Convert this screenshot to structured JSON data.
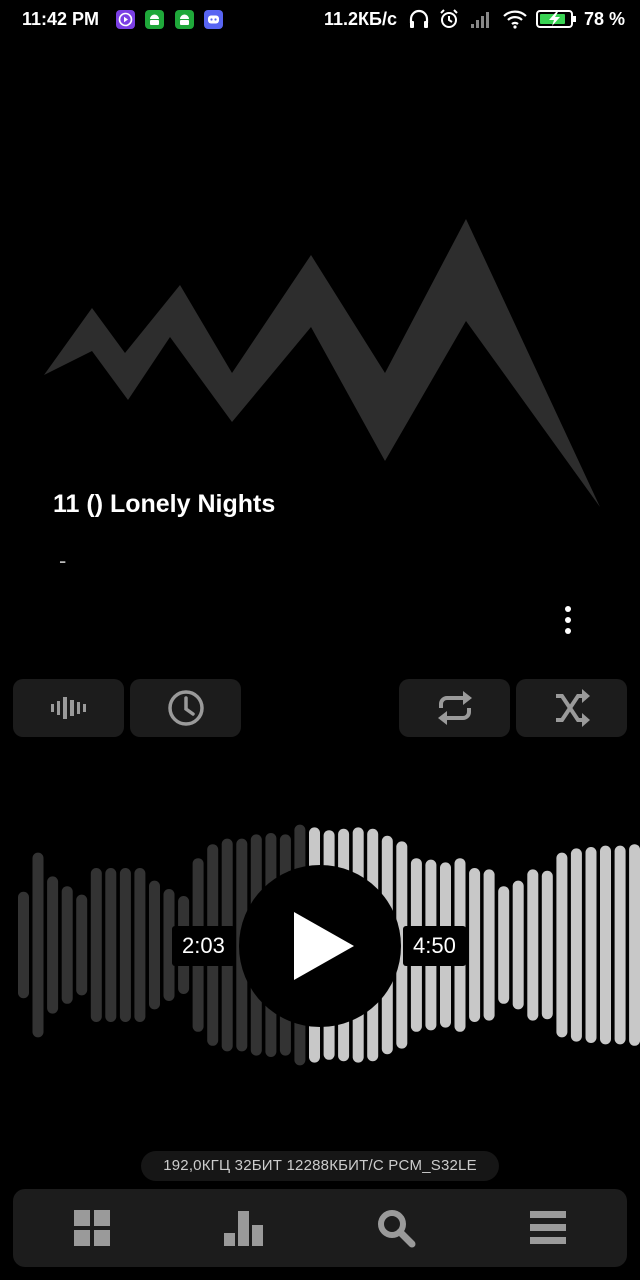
{
  "status_bar": {
    "time": "11:42 PM",
    "network_speed": "11.2КБ/с",
    "battery_percent": "78 %",
    "app_icons": [
      "video-app-icon",
      "android-icon",
      "android-icon",
      "discord-icon"
    ],
    "icons": [
      "headphones-icon",
      "alarm-icon",
      "signal-icon",
      "wifi-icon",
      "battery-charging-icon"
    ]
  },
  "track": {
    "title": "11 () Lonely Nights",
    "artist": "-"
  },
  "controls": {
    "visualizer_icon": "waveform-icon",
    "sleep_timer_icon": "clock-icon",
    "repeat_icon": "repeat-icon",
    "shuffle_icon": "shuffle-icon"
  },
  "player": {
    "elapsed": "2:03",
    "total": "4:50",
    "progress": 0.424,
    "play_icon": "play-icon"
  },
  "format_info": "192,0КГЦ  32БИТ 12288КБИТ/С  PCM_S32LE",
  "bottom_nav": {
    "items": [
      "grid-icon",
      "bar-chart-icon",
      "search-icon",
      "menu-icon"
    ]
  },
  "colors": {
    "background": "#000000",
    "button_bg": "#1c1c1c",
    "wave_played": "#333333",
    "wave_unplayed": "#c8c8c8",
    "icon": "#9a9a9a"
  }
}
